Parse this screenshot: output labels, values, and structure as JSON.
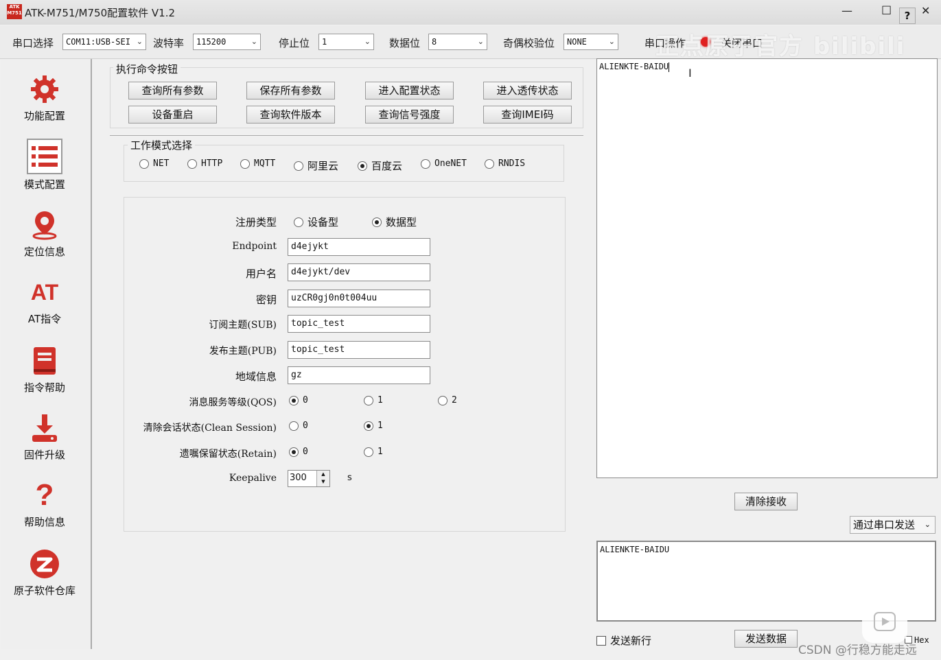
{
  "window": {
    "title": "ATK-M751/M750配置软件 V1.2",
    "logo_text": "ATK M751",
    "help_glyph": "?"
  },
  "toolbar": {
    "port_label": "串口选择",
    "port_value": "COM11:USB-SEI",
    "baud_label": "波特率",
    "baud_value": "115200",
    "stop_label": "停止位",
    "stop_value": "1",
    "data_label": "数据位",
    "data_value": "8",
    "parity_label": "奇偶校验位",
    "parity_value": "NONE",
    "op_label": "串口操作",
    "close_label": "关闭串口",
    "status_color": "#e02020"
  },
  "watermark": {
    "text": "正点原子官方 bilibili"
  },
  "sidebar": {
    "items": [
      {
        "label": "功能配置",
        "icon": "gear-icon"
      },
      {
        "label": "模式配置",
        "icon": "list-icon"
      },
      {
        "label": "定位信息",
        "icon": "location-pin-icon"
      },
      {
        "label": "AT指令",
        "icon": "at-icon",
        "glyph": "AT"
      },
      {
        "label": "指令帮助",
        "icon": "book-icon"
      },
      {
        "label": "固件升级",
        "icon": "download-icon"
      },
      {
        "label": "帮助信息",
        "icon": "question-icon",
        "glyph": "?"
      },
      {
        "label": "原子软件仓库",
        "icon": "repository-icon"
      }
    ]
  },
  "commands": {
    "title": "执行命令按钮",
    "buttons": [
      "查询所有参数",
      "保存所有参数",
      "进入配置状态",
      "进入透传状态",
      "设备重启",
      "查询软件版本",
      "查询信号强度",
      "查询IMEI码"
    ]
  },
  "mode": {
    "title": "工作模式选择",
    "options": [
      "NET",
      "HTTP",
      "MQTT",
      "阿里云",
      "百度云",
      "OneNET",
      "RNDIS"
    ],
    "selected": "百度云"
  },
  "config": {
    "reg_type_label": "注册类型",
    "reg_type_options": [
      "设备型",
      "数据型"
    ],
    "reg_type_selected": "数据型",
    "endpoint_label": "Endpoint",
    "endpoint_value": "d4ejykt",
    "user_label": "用户名",
    "user_value": "d4ejykt/dev",
    "key_label": "密钥",
    "key_value": "uzCR0gj0n0t004uu",
    "sub_label": "订阅主题(SUB)",
    "sub_value": "topic_test",
    "pub_label": "发布主题(PUB)",
    "pub_value": "topic_test",
    "region_label": "地域信息",
    "region_value": "gz",
    "qos_label": "消息服务等级(QOS)",
    "qos_options": [
      "0",
      "1",
      "2"
    ],
    "qos_selected": "0",
    "clean_label": "清除会话状态(Clean Session)",
    "clean_options": [
      "0",
      "1"
    ],
    "clean_selected": "1",
    "retain_label": "遗嘱保留状态(Retain)",
    "retain_options": [
      "0",
      "1"
    ],
    "retain_selected": "0",
    "keepalive_label": "Keepalive",
    "keepalive_value": "300",
    "keepalive_unit": "s"
  },
  "receive": {
    "text": "ALIENKTE-BAIDU",
    "clear_button": "清除接收"
  },
  "send": {
    "mode_value": "通过串口发送",
    "text": "ALIENKTE-BAIDU",
    "newline_label": "发送新行",
    "send_button": "发送数据",
    "hex_label": "Hex"
  },
  "footer_watermark": "CSDN @行稳方能走远"
}
